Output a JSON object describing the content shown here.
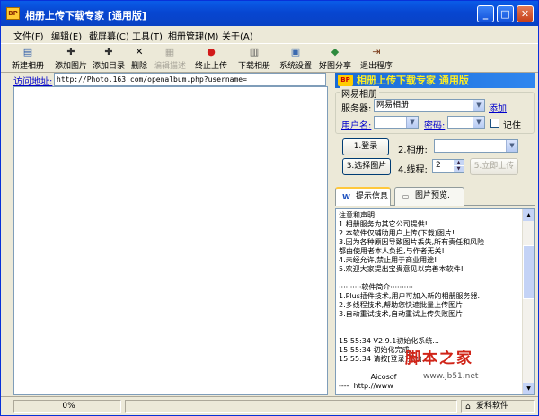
{
  "window": {
    "title": "相册上传下载专家 [通用版]",
    "app_icon_text": "BP"
  },
  "menus": [
    "文件(F)",
    "编辑(E)",
    "截屏幕(C)",
    "工具(T)",
    "相册管理(M)",
    "关于(A)"
  ],
  "toolbar": [
    {
      "label": "新建相册",
      "icon": "new-album-icon",
      "glyph": "▤"
    },
    {
      "label": "添加图片",
      "icon": "add-image-icon",
      "glyph": "✚"
    },
    {
      "label": "添加目录",
      "icon": "add-folder-icon",
      "glyph": "✚"
    },
    {
      "label": "删除",
      "icon": "delete-icon",
      "glyph": "✕"
    },
    {
      "label": "编辑描述",
      "icon": "edit-desc-icon",
      "glyph": "▦",
      "disabled": true
    },
    {
      "label": "终止上传",
      "icon": "stop-icon",
      "glyph": "●"
    },
    {
      "label": "下载相册",
      "icon": "download-icon",
      "glyph": "▥"
    },
    {
      "label": "系统设置",
      "icon": "settings-icon",
      "glyph": "▣"
    },
    {
      "label": "好图分享",
      "icon": "share-icon",
      "glyph": "◆"
    },
    {
      "label": "退出程序",
      "icon": "exit-icon",
      "glyph": "⇥"
    }
  ],
  "address": {
    "label": "访问地址:",
    "value": "http://Photo.163.com/openalbum.php?username="
  },
  "banner": {
    "logo": "BP",
    "text": "相册上传下载专家 通用版"
  },
  "account": {
    "group_title": "网易相册",
    "server_label": "服务器:",
    "server_value": "网易相册",
    "add_link": "添加",
    "username_label": "用户名:",
    "password_label": "密码:",
    "remember_label": "记住"
  },
  "actions": {
    "login": "1.登录",
    "album_label": "2.相册:",
    "select_images": "3.选择图片",
    "threads_label": "4.线程:",
    "threads_value": "2",
    "upload_now": "5.立即上传"
  },
  "tabs": [
    {
      "label": "提示信息",
      "icon": "info-icon",
      "glyph": "W"
    },
    {
      "label": "图片预览.",
      "icon": "preview-icon",
      "glyph": "▭"
    }
  ],
  "log": [
    "注意和声明:",
    "1.相册服务为其它公司提供!",
    "2.本软件仅辅助用户上传(下载)图片!",
    "3.因为各种原因导致图片丢失,所有责任和风险",
    "都由使用者本人负担,与作者无关!",
    "4.未经允许,禁止用于商业用途!",
    "5.欢迎大家提出宝贵意见以完善本软件!",
    "",
    "··········软件简介··········",
    "1.Plus插件技术,用户可加入新的相册服务器.",
    "2.多线程技术,帮助您快速批量上传图片.",
    "3.自动重试技术,自动重试上传失败图片.",
    "",
    "",
    "15:55:34 V2.9.1初始化系统...",
    "15:55:34 初始化完成.",
    "15:55:34 请按[登录]开始...",
    "",
    "              Aicosof",
    "----  http://www"
  ],
  "watermark": {
    "text": "脚本之家",
    "url": "www.jb51.net"
  },
  "status": {
    "progress": "0%",
    "brand": "爱科软件"
  }
}
